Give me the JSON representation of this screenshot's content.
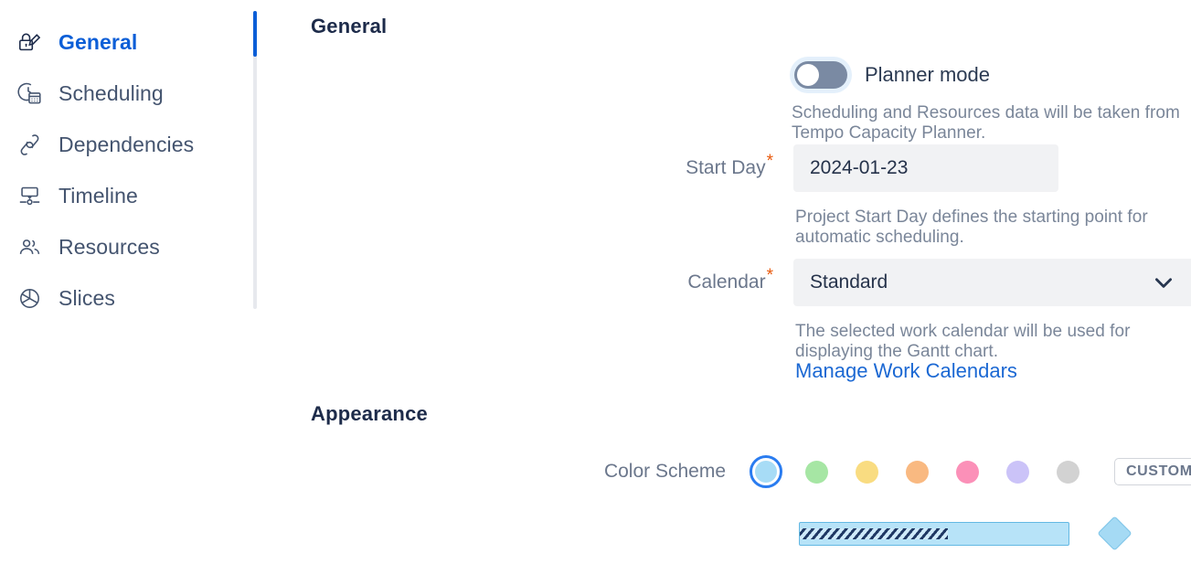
{
  "sidebar": {
    "items": [
      {
        "label": "General",
        "icon": "lock-edit-icon",
        "active": true
      },
      {
        "label": "Scheduling",
        "icon": "clock-calendar-icon",
        "active": false
      },
      {
        "label": "Dependencies",
        "icon": "link-chain-icon",
        "active": false
      },
      {
        "label": "Timeline",
        "icon": "timeline-icon",
        "active": false
      },
      {
        "label": "Resources",
        "icon": "people-icon",
        "active": false
      },
      {
        "label": "Slices",
        "icon": "pie-slices-icon",
        "active": false
      }
    ]
  },
  "content": {
    "general_heading": "General",
    "appearance_heading": "Appearance",
    "planner_mode": {
      "label": "Planner mode",
      "enabled": false,
      "helper": "Scheduling and Resources data will be taken from Tempo Capacity Planner."
    },
    "start_day": {
      "label": "Start Day",
      "required_marker": "*",
      "value": "2024-01-23",
      "helper": "Project Start Day defines the starting point for automatic scheduling."
    },
    "calendar": {
      "label": "Calendar",
      "required_marker": "*",
      "value": "Standard",
      "helper": "The selected work calendar will be used for displaying the Gantt chart.",
      "manage_link": "Manage Work Calendars"
    },
    "color_scheme": {
      "label": "Color Scheme",
      "custom_button": "CUSTOM",
      "selected_index": 0,
      "swatches": [
        {
          "name": "blue",
          "color": "#a7dcf6"
        },
        {
          "name": "green",
          "color": "#a6e6a4"
        },
        {
          "name": "yellow",
          "color": "#f9dc81"
        },
        {
          "name": "orange",
          "color": "#f9b981"
        },
        {
          "name": "pink",
          "color": "#fb90b8"
        },
        {
          "name": "lavender",
          "color": "#cbc3f8"
        },
        {
          "name": "gray",
          "color": "#d2d2d2"
        }
      ]
    },
    "preview": {
      "bar_fill": "#b7e3f8",
      "bar_border": "#63b8e3",
      "progress_color": "#1f3864",
      "milestone_color": "#a5daf4"
    }
  },
  "theme": {
    "accent": "#0b5ed7",
    "heading": "#1d2b4a",
    "muted": "#6b778c",
    "required": "#e8590c",
    "link": "#1b68d3"
  }
}
